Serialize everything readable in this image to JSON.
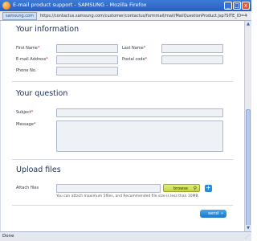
{
  "window": {
    "title": "E-mail product support - SAMSUNG - Mozilla Firefox",
    "minimize_glyph": "_",
    "maximize_glyph": "□",
    "close_glyph": "x"
  },
  "addressbar": {
    "site_label": "samsung.com",
    "url": "https://contactus.samsung.com/customer/contactus/formmail/mail/MailQuestionProduct.jsp?SITE_ID=46"
  },
  "sections": {
    "info_title": "Your information",
    "question_title": "Your question",
    "upload_title": "Upload files"
  },
  "fields": {
    "first_name": "First Name",
    "last_name": "Last Name",
    "email": "E-mail Address",
    "postal_code": "Postal code",
    "phone": "Phone No.",
    "subject": "Subject",
    "message": "Message",
    "attach": "Attach files",
    "required_mark": "*"
  },
  "upload": {
    "browse_label": "browse",
    "add_glyph": "+",
    "hint": "You can attach maximum 5files, and Recommended file size is less than 10MB."
  },
  "actions": {
    "send_label": "send",
    "send_icon": "»"
  },
  "status": {
    "text": "Done",
    "grip": "⋰"
  }
}
